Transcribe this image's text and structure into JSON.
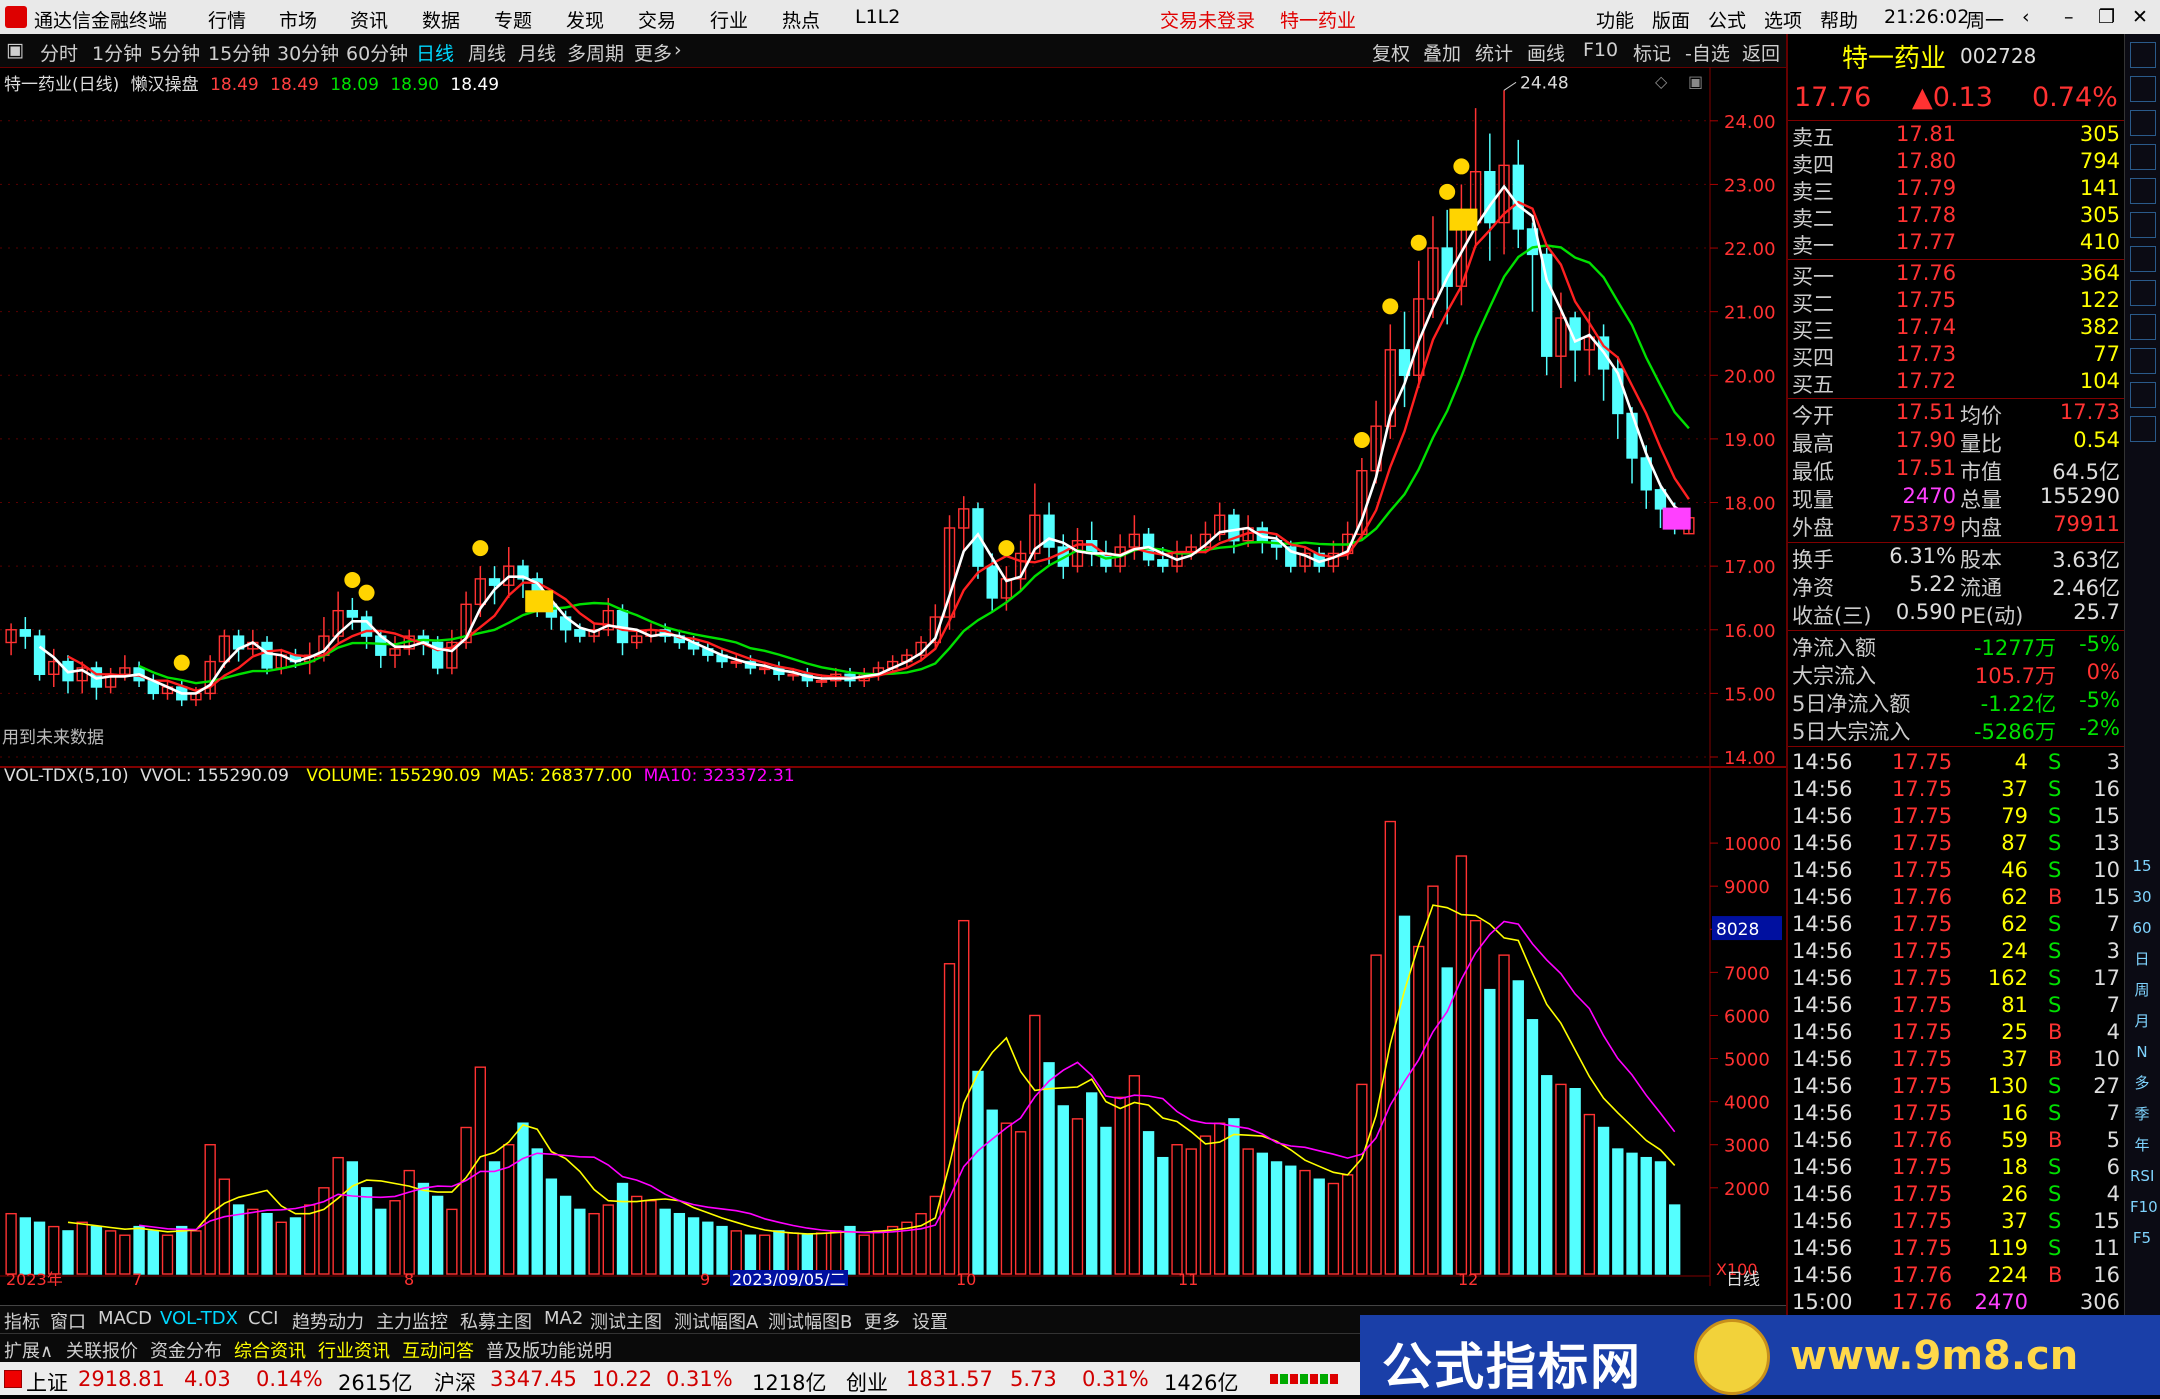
{
  "app": {
    "name": "通达信金融终端",
    "menu": [
      "行情",
      "市场",
      "资讯",
      "数据",
      "专题",
      "发现",
      "交易",
      "行业",
      "热点",
      "L1L2"
    ],
    "notice": [
      "交易未登录",
      "特一药业"
    ],
    "right_menu": [
      "功能",
      "版面",
      "公式",
      "选项",
      "帮助"
    ],
    "time": "21:26:02",
    "weekday": "周一"
  },
  "periods": [
    "分时",
    "1分钟",
    "5分钟",
    "15分钟",
    "30分钟",
    "60分钟",
    "日线",
    "周线",
    "月线",
    "多周期",
    "更多"
  ],
  "selected_period": "日线",
  "toolbar_right": [
    "复权",
    "叠加",
    "统计",
    "画线",
    "F10",
    "标记",
    "-自选",
    "返回"
  ],
  "main_chart": {
    "title": "特一药业(日线)",
    "indicator": "懒汉操盘",
    "values": [
      "18.49",
      "18.49",
      "18.09",
      "18.90",
      "18.49"
    ],
    "high_mark": "24.48",
    "note": "用到未来数据",
    "y_ticks": [
      "24.00",
      "23.00",
      "22.00",
      "21.00",
      "20.00",
      "19.00",
      "18.00",
      "17.00",
      "16.00",
      "15.00",
      "14.00"
    ]
  },
  "vol_chart": {
    "label": "VOL-TDX(5,10)",
    "vvol": "VVOL: 155290.09",
    "volume": "VOLUME: 155290.09",
    "ma5": "MA5: 268377.00",
    "ma10": "MA10: 323372.31",
    "y_ticks": [
      "10000",
      "9000",
      "8000",
      "7000",
      "6000",
      "5000",
      "4000",
      "3000",
      "2000"
    ],
    "cursor_label": "8028",
    "unit": "X100"
  },
  "x_axis": {
    "labels": [
      "2023年",
      "7",
      "8",
      "9",
      "2023/09/05/二",
      "10",
      "11",
      "12"
    ],
    "period": "日线"
  },
  "stock": {
    "name": "特一药业",
    "code": "002728",
    "price": "17.76",
    "change": "▲0.13",
    "pct": "0.74%"
  },
  "orderbook": [
    {
      "label": "卖五",
      "price": "17.81",
      "vol": "305"
    },
    {
      "label": "卖四",
      "price": "17.80",
      "vol": "794"
    },
    {
      "label": "卖三",
      "price": "17.79",
      "vol": "141"
    },
    {
      "label": "卖二",
      "price": "17.78",
      "vol": "305"
    },
    {
      "label": "卖一",
      "price": "17.77",
      "vol": "410"
    },
    {
      "label": "买一",
      "price": "17.76",
      "vol": "364"
    },
    {
      "label": "买二",
      "price": "17.75",
      "vol": "122"
    },
    {
      "label": "买三",
      "price": "17.74",
      "vol": "382"
    },
    {
      "label": "买四",
      "price": "17.73",
      "vol": "77"
    },
    {
      "label": "买五",
      "price": "17.72",
      "vol": "104"
    }
  ],
  "quote_stats": [
    [
      "今开",
      "17.51",
      "均价",
      "17.73"
    ],
    [
      "最高",
      "17.90",
      "量比",
      "0.54"
    ],
    [
      "最低",
      "17.51",
      "市值",
      "64.5亿"
    ],
    [
      "现量",
      "2470",
      "总量",
      "155290"
    ],
    [
      "外盘",
      "75379",
      "内盘",
      "79911"
    ]
  ],
  "fundamentals": [
    [
      "换手",
      "6.31%",
      "股本",
      "3.63亿"
    ],
    [
      "净资",
      "5.22",
      "流通",
      "2.46亿"
    ],
    [
      "收益(三)",
      "0.590",
      "PE(动)",
      "25.7"
    ]
  ],
  "flows": [
    [
      "净流入额",
      "-1277万",
      "-5%"
    ],
    [
      "大宗流入",
      "105.7万",
      "0%"
    ],
    [
      "5日净流入额",
      "-1.22亿",
      "-5%"
    ],
    [
      "5日大宗流入",
      "-5286万",
      "-2%"
    ]
  ],
  "ticks": [
    [
      "14:56",
      "17.75",
      "4",
      "S",
      "3"
    ],
    [
      "14:56",
      "17.75",
      "37",
      "S",
      "16"
    ],
    [
      "14:56",
      "17.75",
      "79",
      "S",
      "15"
    ],
    [
      "14:56",
      "17.75",
      "87",
      "S",
      "13"
    ],
    [
      "14:56",
      "17.75",
      "46",
      "S",
      "10"
    ],
    [
      "14:56",
      "17.76",
      "62",
      "B",
      "15"
    ],
    [
      "14:56",
      "17.75",
      "62",
      "S",
      "7"
    ],
    [
      "14:56",
      "17.75",
      "24",
      "S",
      "3"
    ],
    [
      "14:56",
      "17.75",
      "162",
      "S",
      "17"
    ],
    [
      "14:56",
      "17.75",
      "81",
      "S",
      "7"
    ],
    [
      "14:56",
      "17.75",
      "25",
      "B",
      "4"
    ],
    [
      "14:56",
      "17.75",
      "37",
      "B",
      "10"
    ],
    [
      "14:56",
      "17.75",
      "130",
      "S",
      "27"
    ],
    [
      "14:56",
      "17.75",
      "16",
      "S",
      "7"
    ],
    [
      "14:56",
      "17.76",
      "59",
      "B",
      "5"
    ],
    [
      "14:56",
      "17.75",
      "18",
      "S",
      "6"
    ],
    [
      "14:56",
      "17.75",
      "26",
      "S",
      "4"
    ],
    [
      "14:56",
      "17.75",
      "37",
      "S",
      "15"
    ],
    [
      "14:56",
      "17.75",
      "119",
      "S",
      "11"
    ],
    [
      "14:56",
      "17.76",
      "224",
      "B",
      "16"
    ],
    [
      "15:00",
      "17.76",
      "2470",
      "",
      "306"
    ]
  ],
  "side_icons": [
    "15",
    "30",
    "60",
    "日",
    "周",
    "月",
    "N",
    "多",
    "季",
    "年",
    "RSI",
    "F10",
    "F5"
  ],
  "tabs": [
    "指标",
    "窗口",
    "MACD",
    "VOL-TDX",
    "CCI",
    "趋势动力",
    "主力监控",
    "私募主图",
    "MA2",
    "测试主图",
    "测试幅图A",
    "测试幅图B",
    "更多",
    "设置"
  ],
  "selected_tab": "VOL-TDX",
  "tabs2": [
    "扩展∧",
    "关联报价",
    "资金分布",
    "综合资讯",
    "行业资讯",
    "互动问答",
    "普及版功能说明"
  ],
  "status": {
    "sh": {
      "name": "上证",
      "value": "2918.81",
      "chg": "4.03",
      "pct": "0.14%",
      "amt": "2615亿"
    },
    "hs": {
      "name": "沪深",
      "value": "3347.45",
      "chg": "10.22",
      "pct": "0.31%",
      "amt": "1218亿"
    },
    "cy": {
      "name": "创业",
      "value": "1831.57",
      "chg": "5.73",
      "pct": "0.31%",
      "amt": "1426亿"
    }
  },
  "watermark": {
    "text": "公式指标网",
    "url": "www.9m8.cn"
  },
  "colors": {
    "up": "#ff3232",
    "down": "#54ffff",
    "ma5": "#ffffff",
    "ma10": "#ff2020",
    "ma20": "#00e000",
    "vol_ma5": "#ffff00",
    "vol_ma10": "#ff00ff"
  },
  "chart_data": {
    "type": "candlestick",
    "y_range": [
      14.0,
      24.5
    ],
    "candles": [
      [
        15.8,
        16.0,
        15.6,
        16.1
      ],
      [
        16.0,
        15.9,
        15.7,
        16.2
      ],
      [
        15.9,
        15.3,
        15.2,
        16.0
      ],
      [
        15.3,
        15.5,
        15.1,
        15.7
      ],
      [
        15.5,
        15.2,
        15.0,
        15.6
      ],
      [
        15.2,
        15.4,
        15.0,
        15.5
      ],
      [
        15.4,
        15.1,
        14.9,
        15.5
      ],
      [
        15.1,
        15.3,
        15.0,
        15.4
      ],
      [
        15.3,
        15.4,
        15.2,
        15.6
      ],
      [
        15.4,
        15.2,
        15.1,
        15.5
      ],
      [
        15.2,
        15.0,
        14.9,
        15.3
      ],
      [
        15.0,
        15.1,
        14.9,
        15.2
      ],
      [
        15.1,
        14.9,
        14.8,
        15.2
      ],
      [
        14.9,
        15.0,
        14.8,
        15.1
      ],
      [
        15.0,
        15.5,
        14.9,
        15.6
      ],
      [
        15.5,
        15.9,
        15.4,
        16.0
      ],
      [
        15.9,
        15.7,
        15.5,
        16.0
      ],
      [
        15.7,
        15.8,
        15.6,
        16.0
      ],
      [
        15.8,
        15.4,
        15.3,
        15.9
      ],
      [
        15.4,
        15.6,
        15.3,
        15.7
      ],
      [
        15.6,
        15.5,
        15.4,
        15.7
      ],
      [
        15.5,
        15.6,
        15.3,
        15.8
      ],
      [
        15.6,
        15.9,
        15.5,
        16.2
      ],
      [
        15.9,
        16.3,
        15.8,
        16.6
      ],
      [
        16.3,
        16.2,
        16.0,
        16.5
      ],
      [
        16.2,
        15.9,
        15.7,
        16.3
      ],
      [
        15.9,
        15.6,
        15.4,
        16.0
      ],
      [
        15.6,
        15.7,
        15.4,
        15.9
      ],
      [
        15.7,
        15.9,
        15.6,
        16.0
      ],
      [
        15.9,
        15.8,
        15.6,
        16.0
      ],
      [
        15.8,
        15.4,
        15.3,
        15.9
      ],
      [
        15.4,
        15.8,
        15.3,
        16.0
      ],
      [
        15.8,
        16.4,
        15.7,
        16.6
      ],
      [
        16.4,
        16.8,
        16.2,
        17.0
      ],
      [
        16.8,
        16.7,
        16.4,
        17.0
      ],
      [
        16.7,
        17.0,
        16.5,
        17.3
      ],
      [
        17.0,
        16.8,
        16.5,
        17.1
      ],
      [
        16.8,
        16.4,
        16.2,
        16.9
      ],
      [
        16.4,
        16.2,
        16.0,
        16.5
      ],
      [
        16.2,
        16.0,
        15.8,
        16.3
      ],
      [
        16.0,
        15.9,
        15.8,
        16.1
      ],
      [
        15.9,
        16.0,
        15.8,
        16.1
      ],
      [
        16.0,
        16.3,
        15.9,
        16.5
      ],
      [
        16.3,
        15.8,
        15.6,
        16.4
      ],
      [
        15.8,
        15.9,
        15.7,
        16.0
      ],
      [
        15.9,
        16.0,
        15.8,
        16.1
      ],
      [
        16.0,
        15.9,
        15.8,
        16.1
      ],
      [
        15.9,
        15.8,
        15.7,
        16.0
      ],
      [
        15.8,
        15.7,
        15.6,
        15.9
      ],
      [
        15.7,
        15.6,
        15.5,
        15.8
      ],
      [
        15.6,
        15.5,
        15.4,
        15.7
      ],
      [
        15.5,
        15.5,
        15.4,
        15.6
      ],
      [
        15.5,
        15.4,
        15.3,
        15.6
      ],
      [
        15.4,
        15.4,
        15.3,
        15.5
      ],
      [
        15.4,
        15.3,
        15.2,
        15.5
      ],
      [
        15.3,
        15.3,
        15.2,
        15.4
      ],
      [
        15.3,
        15.2,
        15.1,
        15.4
      ],
      [
        15.2,
        15.2,
        15.1,
        15.3
      ],
      [
        15.2,
        15.3,
        15.1,
        15.4
      ],
      [
        15.3,
        15.2,
        15.1,
        15.4
      ],
      [
        15.2,
        15.3,
        15.1,
        15.4
      ],
      [
        15.3,
        15.4,
        15.2,
        15.5
      ],
      [
        15.4,
        15.5,
        15.3,
        15.6
      ],
      [
        15.5,
        15.6,
        15.4,
        15.7
      ],
      [
        15.6,
        15.8,
        15.5,
        15.9
      ],
      [
        15.8,
        16.2,
        15.7,
        16.4
      ],
      [
        16.2,
        17.6,
        16.0,
        17.8
      ],
      [
        17.6,
        17.9,
        17.2,
        18.1
      ],
      [
        17.9,
        17.0,
        16.8,
        18.0
      ],
      [
        17.0,
        16.5,
        16.3,
        17.2
      ],
      [
        16.5,
        16.8,
        16.3,
        17.0
      ],
      [
        16.8,
        17.2,
        16.6,
        17.4
      ],
      [
        17.2,
        17.8,
        17.1,
        18.3
      ],
      [
        17.8,
        17.3,
        17.0,
        18.0
      ],
      [
        17.3,
        17.0,
        16.8,
        17.5
      ],
      [
        17.0,
        17.4,
        16.9,
        17.6
      ],
      [
        17.4,
        17.2,
        17.0,
        17.7
      ],
      [
        17.2,
        17.0,
        16.9,
        17.4
      ],
      [
        17.0,
        17.3,
        16.9,
        17.5
      ],
      [
        17.3,
        17.5,
        17.1,
        17.8
      ],
      [
        17.5,
        17.1,
        17.0,
        17.6
      ],
      [
        17.1,
        17.0,
        16.9,
        17.3
      ],
      [
        17.0,
        17.2,
        16.9,
        17.4
      ],
      [
        17.2,
        17.3,
        17.1,
        17.5
      ],
      [
        17.3,
        17.5,
        17.2,
        17.7
      ],
      [
        17.5,
        17.8,
        17.4,
        18.0
      ],
      [
        17.8,
        17.4,
        17.2,
        17.9
      ],
      [
        17.4,
        17.6,
        17.3,
        17.8
      ],
      [
        17.6,
        17.4,
        17.2,
        17.7
      ],
      [
        17.4,
        17.3,
        17.1,
        17.5
      ],
      [
        17.3,
        17.0,
        16.9,
        17.4
      ],
      [
        17.0,
        17.2,
        16.9,
        17.3
      ],
      [
        17.2,
        17.0,
        16.9,
        17.3
      ],
      [
        17.0,
        17.2,
        16.9,
        17.4
      ],
      [
        17.2,
        17.5,
        17.1,
        17.7
      ],
      [
        17.5,
        18.5,
        17.4,
        18.7
      ],
      [
        18.5,
        19.2,
        18.3,
        19.6
      ],
      [
        19.2,
        20.4,
        19.0,
        20.8
      ],
      [
        20.4,
        20.0,
        19.5,
        21.0
      ],
      [
        20.0,
        21.2,
        19.8,
        21.8
      ],
      [
        21.2,
        22.0,
        20.9,
        22.5
      ],
      [
        22.0,
        21.4,
        20.8,
        22.6
      ],
      [
        21.4,
        22.4,
        21.1,
        23.0
      ],
      [
        22.4,
        23.2,
        22.0,
        24.2
      ],
      [
        23.2,
        22.4,
        21.8,
        23.8
      ],
      [
        22.4,
        23.3,
        21.9,
        24.48
      ],
      [
        23.3,
        22.3,
        22.0,
        23.7
      ],
      [
        22.3,
        21.9,
        21.0,
        22.4
      ],
      [
        21.9,
        20.3,
        20.0,
        22.0
      ],
      [
        20.3,
        20.9,
        19.8,
        21.3
      ],
      [
        20.9,
        20.4,
        19.9,
        21.0
      ],
      [
        20.4,
        20.6,
        20.0,
        21.0
      ],
      [
        20.6,
        20.1,
        19.6,
        20.8
      ],
      [
        20.1,
        19.4,
        19.0,
        20.3
      ],
      [
        19.4,
        18.7,
        18.3,
        19.5
      ],
      [
        18.7,
        18.2,
        17.9,
        18.9
      ],
      [
        18.2,
        17.9,
        17.6,
        18.3
      ],
      [
        17.9,
        17.7,
        17.5,
        18.0
      ],
      [
        17.51,
        17.76,
        17.51,
        17.9
      ]
    ],
    "volumes": [
      1400,
      1300,
      1200,
      1100,
      1000,
      1200,
      1100,
      1000,
      900,
      1100,
      1000,
      900,
      1100,
      1000,
      3000,
      2200,
      1600,
      1500,
      1400,
      1200,
      1300,
      1600,
      2000,
      2700,
      2600,
      2000,
      1500,
      1700,
      2400,
      2100,
      1800,
      1500,
      3400,
      4800,
      2600,
      3000,
      3500,
      2900,
      2200,
      1800,
      1500,
      1400,
      1600,
      2100,
      1800,
      1700,
      1500,
      1400,
      1300,
      1200,
      1100,
      1000,
      900,
      900,
      1000,
      950,
      900,
      950,
      1000,
      1100,
      900,
      1000,
      1100,
      1200,
      1400,
      1800,
      7200,
      8200,
      4700,
      3800,
      3500,
      3300,
      6000,
      4900,
      3900,
      3600,
      4200,
      3400,
      4100,
      4600,
      3300,
      2700,
      3000,
      2900,
      3200,
      3500,
      3600,
      2900,
      2800,
      2600,
      2500,
      2400,
      2200,
      2100,
      2300,
      4400,
      7400,
      10500,
      8300,
      7600,
      9000,
      7100,
      9700,
      8200,
      6600,
      7400,
      6800,
      5900,
      4600,
      4400,
      4300,
      3700,
      3400,
      2900,
      2800,
      2700,
      2600,
      1600
    ]
  }
}
